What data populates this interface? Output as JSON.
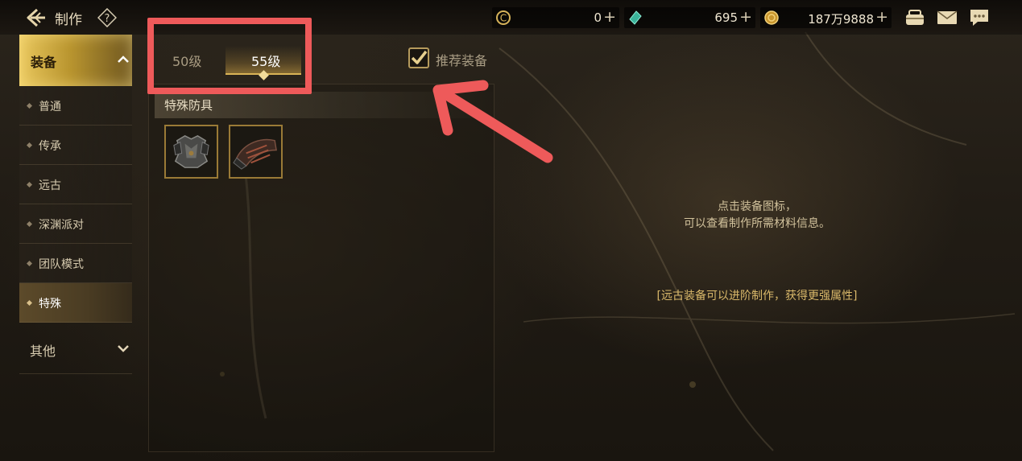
{
  "header": {
    "title": "制作",
    "help_icon": "question-icon",
    "back_icon": "back-arrow-icon"
  },
  "resources": [
    {
      "name": "currency-c",
      "value": "0",
      "icon": "c-coin-icon"
    },
    {
      "name": "gem",
      "value": "695",
      "icon": "green-gem-icon"
    },
    {
      "name": "gold",
      "value": "187万9888",
      "icon": "gold-coin-icon"
    }
  ],
  "top_icons": [
    "pouch-icon",
    "mail-icon",
    "chat-icon"
  ],
  "sidebar": {
    "main_label": "装备",
    "items": [
      {
        "label": "普通"
      },
      {
        "label": "传承"
      },
      {
        "label": "远古"
      },
      {
        "label": "深渊派对"
      },
      {
        "label": "团队模式"
      },
      {
        "label": "特殊"
      }
    ],
    "active_item": "特殊",
    "other_label": "其他"
  },
  "tabs": {
    "level_50": "50级",
    "level_55": "55级",
    "selected": "55级"
  },
  "recommend": {
    "label": "推荐装备",
    "checked": true
  },
  "section": {
    "title": "特殊防具",
    "items": [
      {
        "icon": "armor-chest-icon"
      },
      {
        "icon": "armor-gauntlet-icon"
      }
    ]
  },
  "hint": {
    "line1": "点击装备图标，",
    "line2": "可以查看制作所需材料信息。",
    "line3": "[远古装备可以进阶制作，获得更强属性]"
  },
  "colors": {
    "accent_gold": "#d9b356",
    "annotation_red": "#ee5a5a",
    "text_light": "#e7dcc3"
  }
}
